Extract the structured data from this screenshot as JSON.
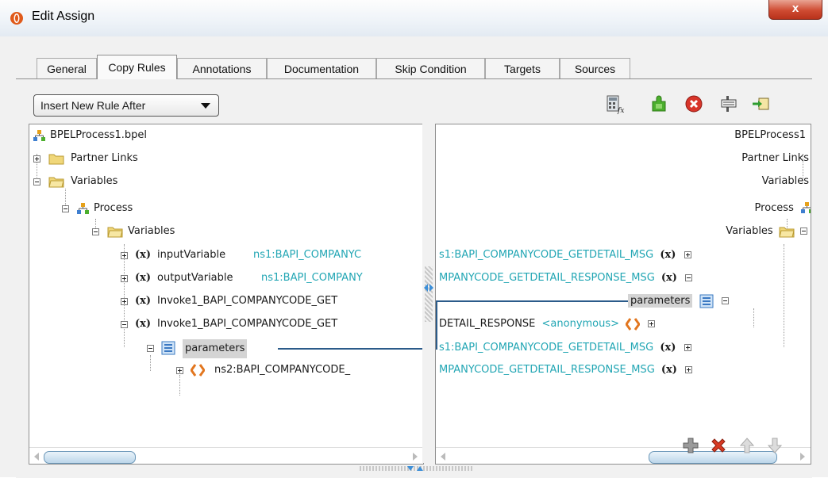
{
  "window": {
    "title": "Edit Assign",
    "close_label": "x"
  },
  "tabs": [
    {
      "label": "General",
      "active": false
    },
    {
      "label": "Copy Rules",
      "active": true
    },
    {
      "label": "Annotations",
      "active": false
    },
    {
      "label": "Documentation",
      "active": false
    },
    {
      "label": "Skip Condition",
      "active": false
    },
    {
      "label": "Targets",
      "active": false
    },
    {
      "label": "Sources",
      "active": false
    }
  ],
  "rule_dropdown": {
    "selected": "Insert New Rule After"
  },
  "toolbar": {
    "icons": [
      "expression-icon",
      "xml-fragment-icon",
      "delete-rule-icon",
      "bulk-copy-icon",
      "transform-icon"
    ]
  },
  "source_tree": {
    "root": "BPELProcess1.bpel",
    "partner_links": "Partner Links",
    "variables": "Variables",
    "process": "Process",
    "process_variables": "Variables",
    "input_var": {
      "name": "inputVariable",
      "type": "ns1:BAPI_COMPANYC"
    },
    "output_var": {
      "name": "outputVariable",
      "type": "ns1:BAPI_COMPANY"
    },
    "invoke_in": "Invoke1_BAPI_COMPANYCODE_GET",
    "invoke_out": "Invoke1_BAPI_COMPANYCODE_GET",
    "parameters": "parameters",
    "ns2": "ns2:BAPI_COMPANYCODE_"
  },
  "target_tree": {
    "root": "BPELProcess1",
    "partner_links": "Partner Links",
    "variables": "Variables",
    "process": "Process",
    "process_variables": "Variables",
    "row1": "s1:BAPI_COMPANYCODE_GETDETAIL_MSG",
    "row2": "MPANYCODE_GETDETAIL_RESPONSE_MSG",
    "parameters": "parameters",
    "row4_name": "DETAIL_RESPONSE",
    "row4_type": "<anonymous>",
    "row5": "s1:BAPI_COMPANYCODE_GETDETAIL_MSG",
    "row6": "MPANYCODE_GETDETAIL_RESPONSE_MSG"
  },
  "colors": {
    "accent": "#2b5b8a",
    "teal": "#22a6b4",
    "close": "#cf4b32"
  },
  "bottom_actions": [
    "add-icon",
    "delete-icon",
    "move-up-icon",
    "move-down-icon"
  ]
}
